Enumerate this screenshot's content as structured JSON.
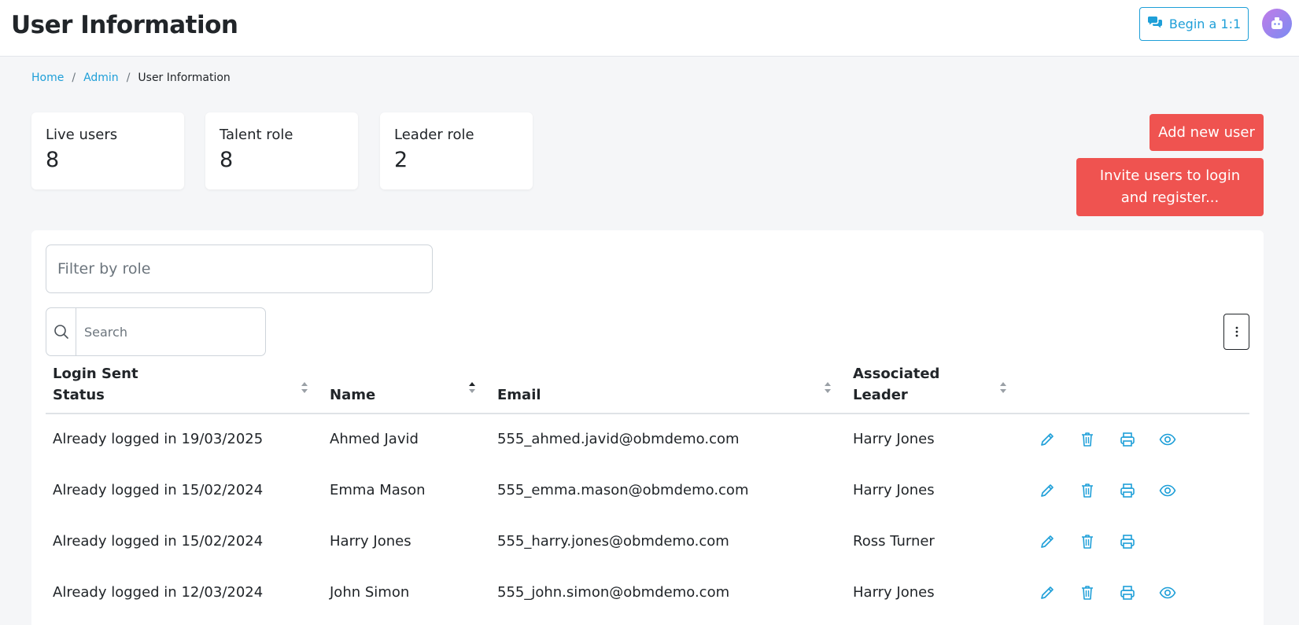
{
  "header": {
    "title": "User Information",
    "begin_button": "Begin a 1:1"
  },
  "breadcrumb": {
    "items": [
      "Home",
      "Admin",
      "User Information"
    ],
    "separator": "/"
  },
  "stats": [
    {
      "label": "Live users",
      "value": "8"
    },
    {
      "label": "Talent role",
      "value": "8"
    },
    {
      "label": "Leader role",
      "value": "2"
    }
  ],
  "actions": {
    "add_user": "Add new user",
    "invite_users": "Invite users to login and register..."
  },
  "filters": {
    "role_placeholder": "Filter by role",
    "search_placeholder": "Search"
  },
  "table": {
    "columns": {
      "login_status": [
        "Login Sent",
        "Status"
      ],
      "name": "Name",
      "email": "Email",
      "leader": [
        "Associated",
        "Leader"
      ]
    },
    "rows": [
      {
        "status": "Already logged in 19/03/2025",
        "name": "Ahmed Javid",
        "email": "555_ahmed.javid@obmdemo.com",
        "leader": "Harry Jones",
        "has_view": true
      },
      {
        "status": "Already logged in 15/02/2024",
        "name": "Emma Mason",
        "email": "555_emma.mason@obmdemo.com",
        "leader": "Harry Jones",
        "has_view": true
      },
      {
        "status": "Already logged in 15/02/2024",
        "name": "Harry Jones",
        "email": "555_harry.jones@obmdemo.com",
        "leader": "Ross Turner",
        "has_view": false
      },
      {
        "status": "Already logged in 12/03/2024",
        "name": "John Simon",
        "email": "555_john.simon@obmdemo.com",
        "leader": "Harry Jones",
        "has_view": true
      }
    ]
  },
  "colors": {
    "accent": "#1e9fd8",
    "danger": "#ef5350"
  },
  "icons": [
    "chat-icon",
    "avatar-icon",
    "search-icon",
    "kebab-icon",
    "sort-icon",
    "edit-icon",
    "delete-icon",
    "print-icon",
    "view-icon"
  ]
}
